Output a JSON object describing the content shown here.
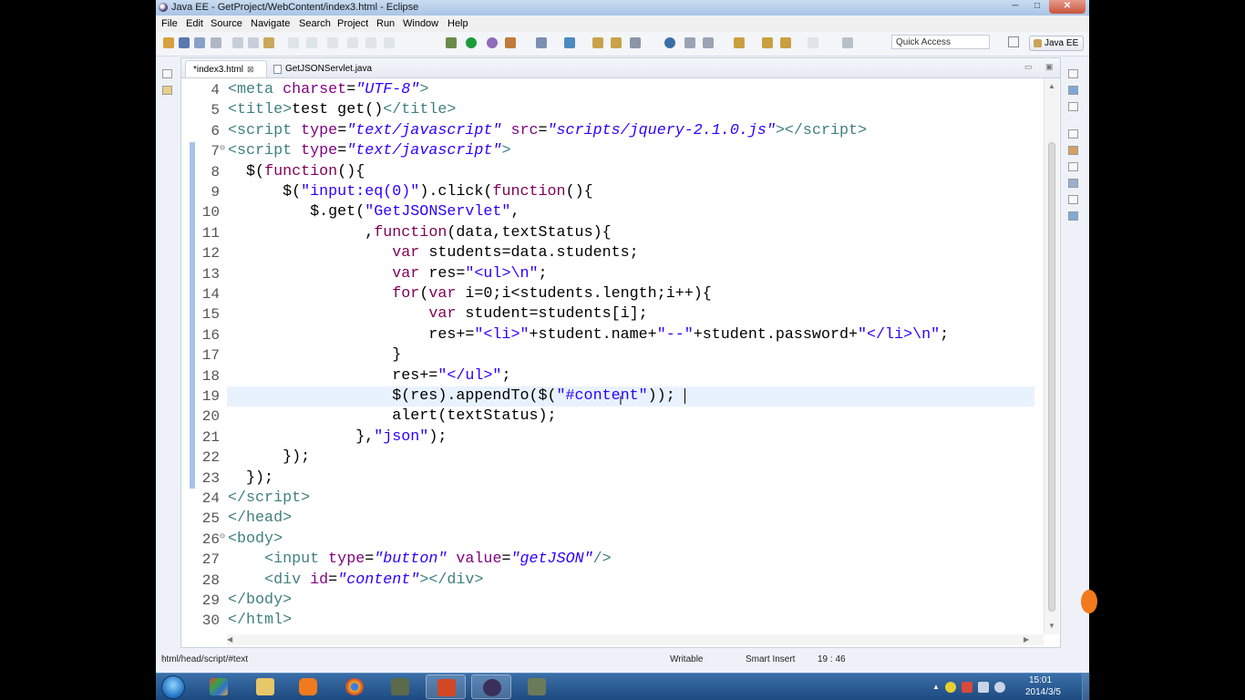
{
  "window": {
    "title": "Java EE - GetProject/WebContent/index3.html - Eclipse",
    "minimize": "─",
    "maximize": "□",
    "close": "✕"
  },
  "menu": [
    "File",
    "Edit",
    "Source",
    "Navigate",
    "Search",
    "Project",
    "Run",
    "Window",
    "Help"
  ],
  "toolbar": {
    "quick_access": "Quick Access",
    "perspective": "Java EE"
  },
  "tabs": [
    {
      "label": "*index3.html",
      "close": "⊠",
      "active": true
    },
    {
      "label": "GetJSONServlet.java",
      "active": false
    }
  ],
  "code_lines": [
    {
      "n": "4",
      "html": "<span class=\"tg\">&lt;meta</span> <span class=\"at\">charset</span>=<span class=\"sv\">\"UTF-8\"</span><span class=\"tg\">&gt;</span>"
    },
    {
      "n": "5",
      "html": "<span class=\"tg\">&lt;title&gt;</span>test get()<span class=\"tg\">&lt;/title&gt;</span>"
    },
    {
      "n": "6",
      "html": "<span class=\"tg\">&lt;script</span> <span class=\"at\">type</span>=<span class=\"sv\">\"text/javascript\"</span> <span class=\"at\">src</span>=<span class=\"sv\">\"scripts/jquery-2.1.0.js\"</span><span class=\"tg\">&gt;&lt;/script&gt;</span>"
    },
    {
      "n": "7",
      "fold": true,
      "html": "<span class=\"tg\">&lt;script</span> <span class=\"at\">type</span>=<span class=\"sv\">\"text/javascript\"</span><span class=\"tg\">&gt;</span>"
    },
    {
      "n": "8",
      "html": "  $(<span class=\"kw\">function</span>(){"
    },
    {
      "n": "9",
      "html": "      $(<span class=\"st\">\"input:eq(0)\"</span>).click(<span class=\"kw\">function</span>(){"
    },
    {
      "n": "10",
      "html": "         $.get(<span class=\"st\">\"GetJSONServlet\"</span>,"
    },
    {
      "n": "11",
      "html": "               ,<span class=\"kw\">function</span>(data,textStatus){"
    },
    {
      "n": "12",
      "html": "                  <span class=\"kw\">var</span> students=data.students;"
    },
    {
      "n": "13",
      "html": "                  <span class=\"kw\">var</span> res=<span class=\"st\">\"&lt;ul&gt;\\n\"</span>;"
    },
    {
      "n": "14",
      "html": "                  <span class=\"kw\">for</span>(<span class=\"kw\">var</span> i=0;i&lt;students.length;i++){"
    },
    {
      "n": "15",
      "html": "                      <span class=\"kw\">var</span> student=students[i];"
    },
    {
      "n": "16",
      "html": "                      res+=<span class=\"st\">\"&lt;li&gt;\"</span>+student.name+<span class=\"st\">\"--\"</span>+student.password+<span class=\"st\">\"&lt;/li&gt;\\n\"</span>;"
    },
    {
      "n": "17",
      "html": "                  }"
    },
    {
      "n": "18",
      "html": "                  res+=<span class=\"st\">\"&lt;/ul&gt;\"</span>;"
    },
    {
      "n": "19",
      "html": "                  $(res).appendTo($(<span class=\"st\">\"#content\"</span>));",
      "current": true
    },
    {
      "n": "20",
      "html": "                  alert(textStatus);"
    },
    {
      "n": "21",
      "html": "              },<span class=\"st\">\"json\"</span>);"
    },
    {
      "n": "22",
      "html": "      });"
    },
    {
      "n": "23",
      "html": "  });"
    },
    {
      "n": "24",
      "html": "<span class=\"tg\">&lt;/script&gt;</span>"
    },
    {
      "n": "25",
      "html": "<span class=\"tg\">&lt;/head&gt;</span>"
    },
    {
      "n": "26",
      "fold": true,
      "html": "<span class=\"tg\">&lt;body&gt;</span>"
    },
    {
      "n": "27",
      "html": "    <span class=\"tg\">&lt;input</span> <span class=\"at\">type</span>=<span class=\"sv\">\"button\"</span> <span class=\"at\">value</span>=<span class=\"sv\">\"getJSON\"</span><span class=\"tg\">/&gt;</span>"
    },
    {
      "n": "28",
      "html": "    <span class=\"tg\">&lt;div</span> <span class=\"at\">id</span>=<span class=\"sv\">\"content\"</span><span class=\"tg\">&gt;&lt;/div&gt;</span>"
    },
    {
      "n": "29",
      "html": "<span class=\"tg\">&lt;/body&gt;</span>"
    },
    {
      "n": "30",
      "html": "<span class=\"tg\">&lt;/html&gt;</span>"
    }
  ],
  "status": {
    "path": "html/head/script/#text",
    "mode": "Writable",
    "insert": "Smart Insert",
    "position": "19 : 46"
  },
  "taskbar": {
    "apps": [
      "start-orb",
      "file-explorer-icon",
      "media-player-icon",
      "chrome-icon",
      "terminal-icon",
      "powerpoint-icon",
      "eclipse-icon",
      "app-icon"
    ],
    "clock_time": "15:01",
    "clock_date": "2014/3/5"
  },
  "colors": {
    "tag": "#3f7f7f",
    "attribute": "#7f007f",
    "string": "#2a00ff",
    "keyword": "#7f0055",
    "current_line": "#e8f2fe"
  }
}
